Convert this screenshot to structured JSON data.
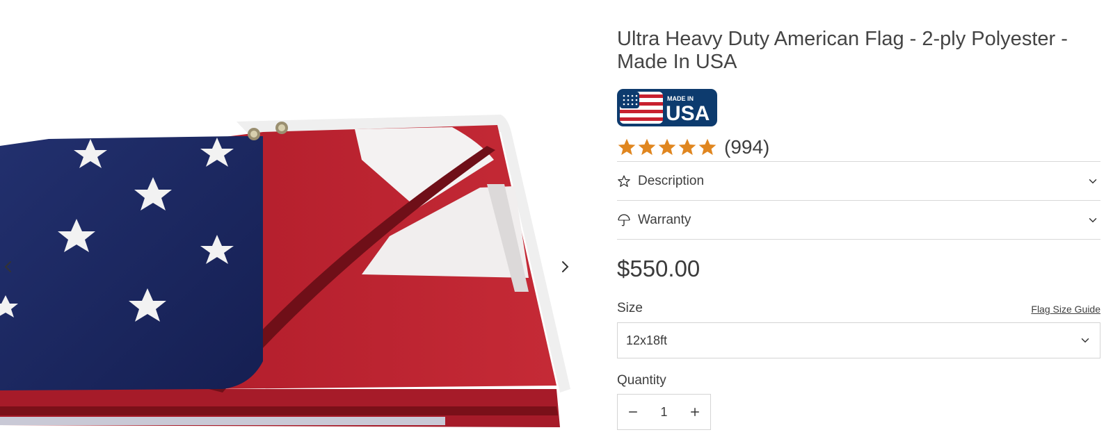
{
  "product": {
    "title": "Ultra Heavy Duty American Flag - 2-ply Polyester - Made In USA",
    "badge": {
      "top_text": "MADE IN",
      "main_text": "USA",
      "color": "#0d3b6e"
    },
    "rating": {
      "stars": 5,
      "max": 5,
      "review_count": "(994)",
      "star_color": "#e0861f"
    },
    "price": "$550.00"
  },
  "accordion": [
    {
      "label": "Description",
      "icon": "star-outline-icon"
    },
    {
      "label": "Warranty",
      "icon": "umbrella-icon"
    }
  ],
  "size": {
    "label": "Size",
    "guide_link": "Flag Size Guide",
    "selected": "12x18ft"
  },
  "quantity": {
    "label": "Quantity",
    "value": "1"
  },
  "gallery": {
    "prev_icon": "chevron-left-icon",
    "next_icon": "chevron-right-icon"
  },
  "colors": {
    "flag_red": "#b4202e",
    "flag_blue": "#1b2a66",
    "flag_white": "#f4f2f2"
  }
}
